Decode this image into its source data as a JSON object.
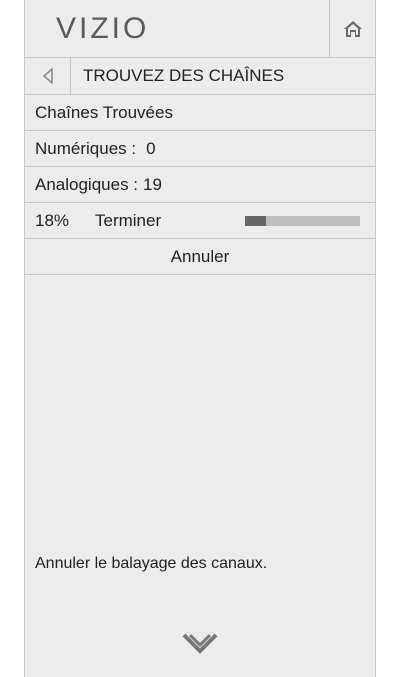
{
  "header": {
    "logo_text": "VIZIO",
    "home_icon": "home-icon"
  },
  "titlebar": {
    "back_icon": "back-arrow-icon",
    "title": "TROUVEZ DES CHAÎNES"
  },
  "rows": {
    "found_label": "Chaînes Trouvées",
    "digital_label": "Numériques :",
    "digital_value": "0",
    "analog_label": "Analogiques :",
    "analog_value": "19",
    "progress_percent_text": "18%",
    "progress_label": "Terminer",
    "progress_fraction": 0.18,
    "cancel_label": "Annuler"
  },
  "help_text": "Annuler le balayage des canaux.",
  "footer": {
    "scroll_icon": "chevron-down-icon"
  },
  "colors": {
    "panel_bg": "#ececec",
    "border": "#c8c8c8",
    "progress_fill": "#666666",
    "progress_track": "#bdbdbd"
  }
}
